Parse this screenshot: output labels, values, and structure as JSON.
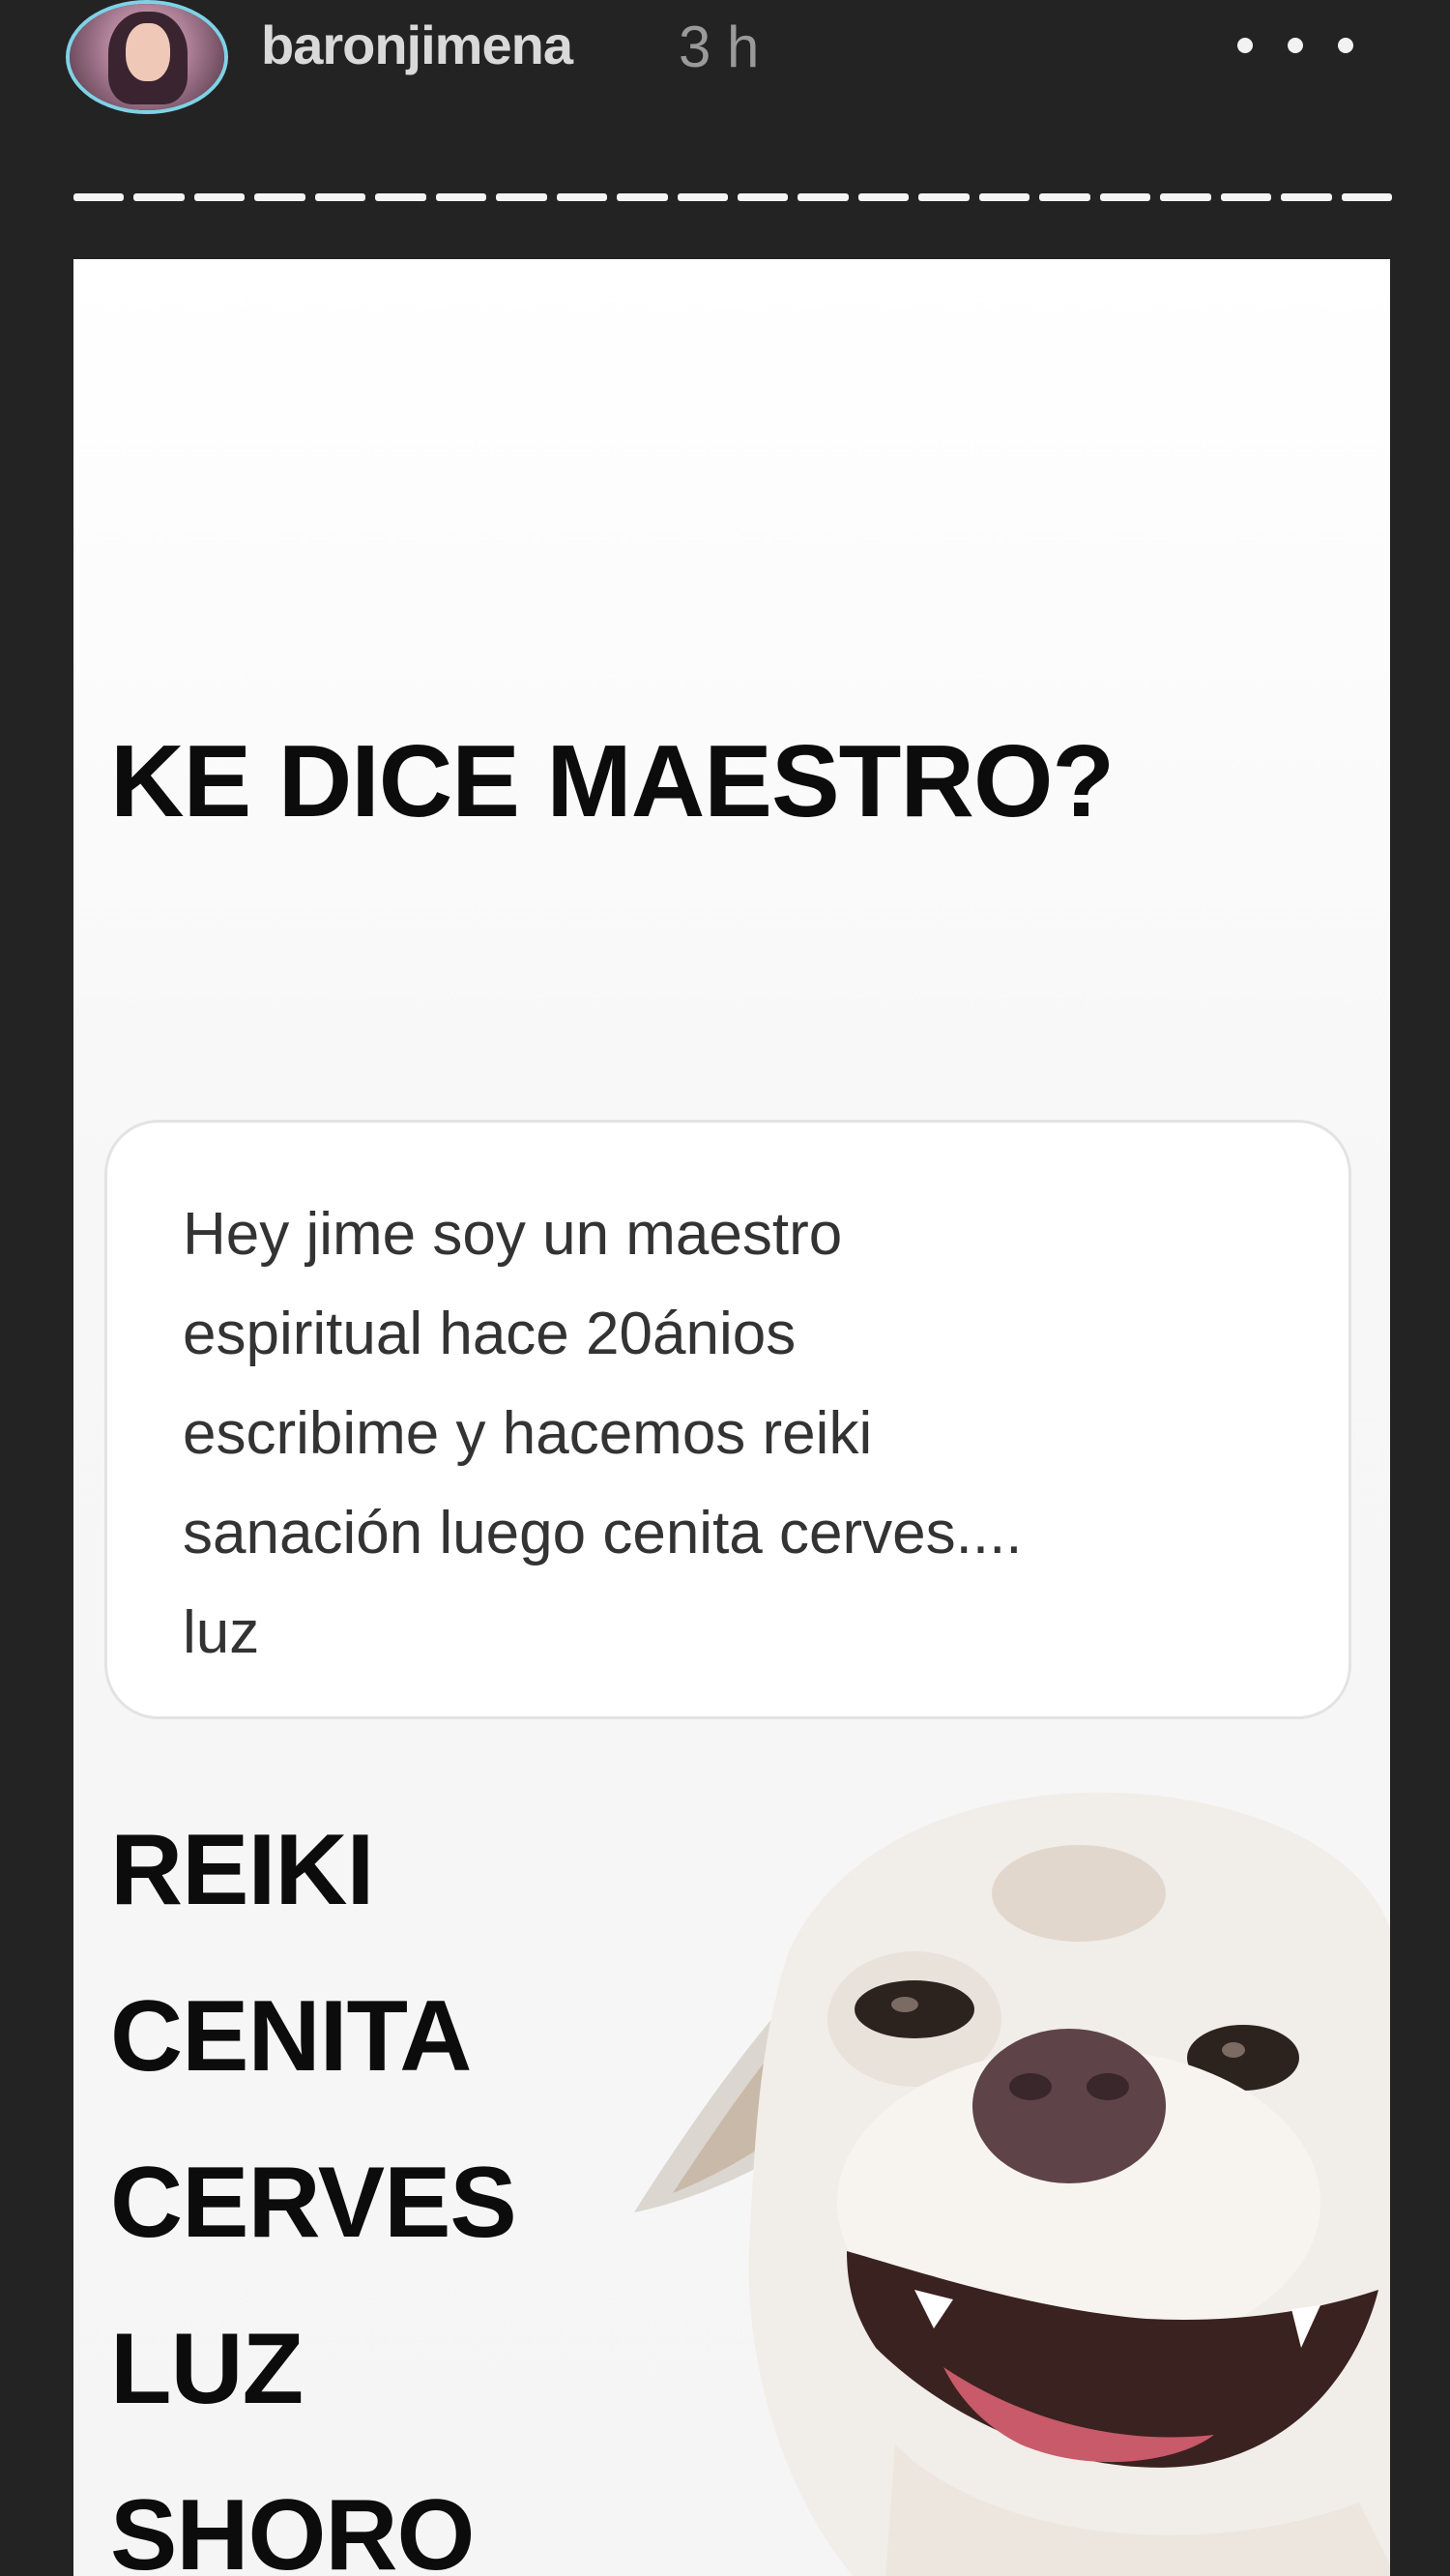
{
  "header": {
    "username": "baronjimena",
    "timestamp": "3 h",
    "more_icon": "more-horizontal-icon"
  },
  "progress": {
    "segments_total": 22,
    "current_segment": 22
  },
  "story": {
    "headline": "KE DICE MAESTRO?",
    "message": "Hey jime soy un maestro\nespiritual hace 20ánios\nescribime y hacemos reiki\nsanación luego cenita cerves....\nluz",
    "words": [
      "REIKI",
      "CENITA",
      "CERVES",
      "LUZ",
      "SHORO"
    ],
    "image_subject": "smiling-dog-meme"
  },
  "colors": {
    "background": "#232323",
    "card": "#ffffff",
    "text_dark": "#0c0c0c",
    "username": "#d9d9d9",
    "timestamp": "#9a9a9a"
  }
}
